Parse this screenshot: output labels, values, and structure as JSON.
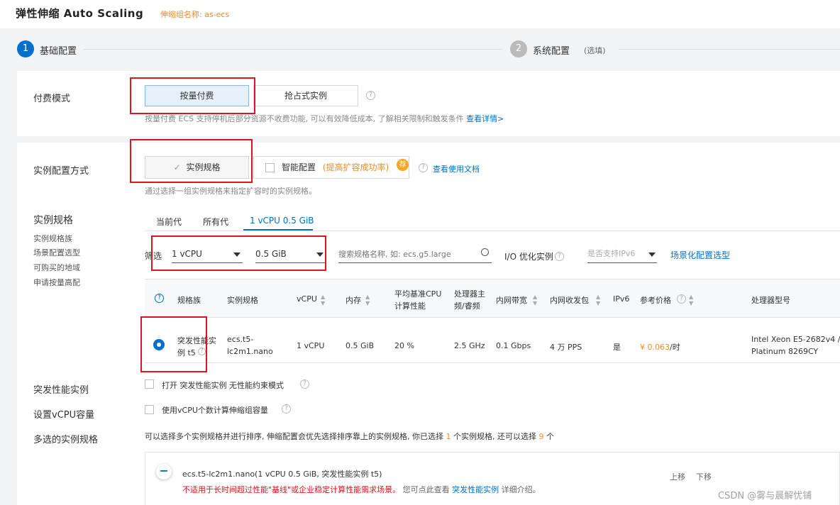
{
  "header": {
    "title": "弹性伸缩 Auto Scaling",
    "group_name": "伸缩组名称: as-ecs"
  },
  "steps": [
    {
      "number": "1",
      "label": "基础配置",
      "active": true
    },
    {
      "number": "2",
      "label": "系统配置",
      "note": "(选填)",
      "active": false
    }
  ],
  "billing": {
    "label": "付费模式",
    "options": [
      "按量付费",
      "抢占式实例"
    ],
    "selected": "按量付费",
    "hint": "按量付费 ECS 支持停机后部分资源不收费功能, 可以有效降低成本, 了解相关限制和触发条件",
    "hint_link": "查看详情>"
  },
  "config_method": {
    "label": "实例配置方式",
    "options": [
      "实例规格",
      "智能配置"
    ],
    "smart_note": "(提高扩容成功率)",
    "badge": "荐",
    "doc_link": "查看使用文档",
    "hint": "通过选择一组实例规格来指定扩容时的实例规格。"
  },
  "spec": {
    "label": "实例规格",
    "side_links": [
      "实例规格族",
      "场景配置选型",
      "可购买的地域",
      "申请按量高配"
    ],
    "tabs": [
      "当前代",
      "所有代",
      "1 vCPU 0.5 GiB"
    ],
    "active_tab": "1 vCPU 0.5 GiB",
    "filter_label": "筛选",
    "cpu_value": "1 vCPU",
    "mem_value": "0.5 GiB",
    "search_placeholder": "搜索规格名称, 如: ecs.g5.large",
    "io_label": "I/O 优化实例",
    "ipv6_placeholder": "是否支持IPv6",
    "scene_link": "场景化配置选型"
  },
  "table": {
    "headers": [
      "规格族",
      "实例规格",
      "vCPU",
      "内存",
      "平均基准CPU",
      "计算性能",
      "处理器主",
      "频/睿频",
      "内网带宽",
      "内网收发包",
      "IPv6",
      "参考价格",
      "处理器型号"
    ],
    "row": {
      "family_line1": "突发性能实",
      "family_line2": "例 t5",
      "spec_line1": "ecs.t5-",
      "spec_line2": "lc2m1.nano",
      "vcpu": "1 vCPU",
      "memory": "0.5 GiB",
      "baseline": "20 %",
      "freq": "2.5 GHz",
      "bandwidth": "0.1 Gbps",
      "pps": "4 万 PPS",
      "ipv6": "是",
      "price": "¥ 0.063",
      "price_unit": "/时",
      "cpu_line1": "Intel Xeon E5-2682v4 /",
      "cpu_line2": "Platinum 8269CY"
    }
  },
  "burst": {
    "label": "突发性能实例",
    "checkbox_text": "打开 突发性能实例 无性能约束模式"
  },
  "vcpu_capacity": {
    "label": "设置vCPU容量",
    "checkbox_text": "使用vCPU个数计算伸缩组容量"
  },
  "multi": {
    "label": "多选的实例规格",
    "hint_pre": "可以选择多个实例规格并进行排序, 伸缩配置会优先选择排序靠上的实例规格, 你已选择",
    "count_selected": "1",
    "hint_mid": "个实例规格, 还可以选择",
    "count_remaining": "9",
    "hint_post": "个",
    "item_title": "ecs.t5-lc2m1.nano(1 vCPU 0.5 GiB, 突发性能实例 t5)",
    "item_warning": "不适用于长时间超过性能\"基线\"或企业稳定计算性能需求场景。",
    "item_hint_pre": "您可点此查看",
    "item_hint_link": "突发性能实例",
    "item_hint_post": "详细介绍。",
    "move_up": "上移",
    "move_down": "下移"
  },
  "watermark": "CSDN @雾与晨解忧铺",
  "colors": {
    "accent": "#0070cc",
    "orange": "#f08c2a",
    "highlight": "#e0141e"
  }
}
